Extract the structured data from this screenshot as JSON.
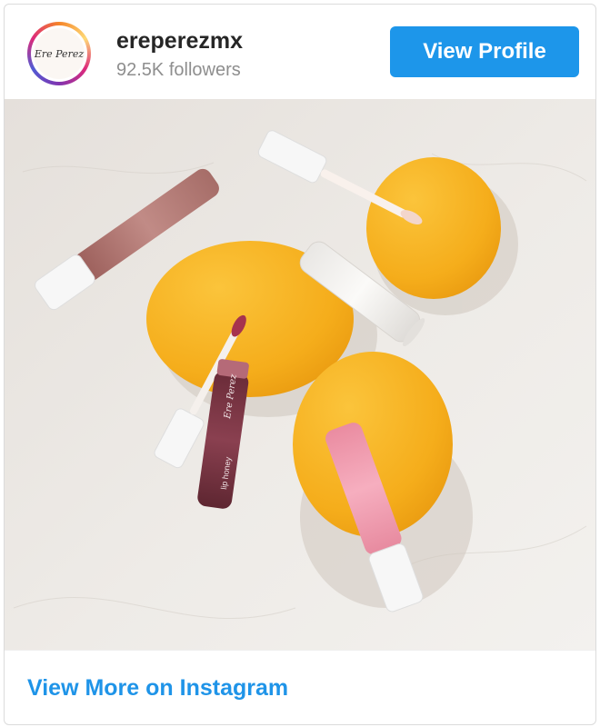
{
  "profile": {
    "username": "ereperezmx",
    "followers": "92.5K followers",
    "avatar_text": "Ere Perez"
  },
  "actions": {
    "view_profile_label": "View Profile",
    "view_more_label": "View More on Instagram"
  },
  "post": {
    "image_label_1": "Ere Perez",
    "image_label_2": "lip honey"
  },
  "colors": {
    "accent": "#1d96ea",
    "link": "#1f94e8",
    "mango": "#f7b523"
  }
}
